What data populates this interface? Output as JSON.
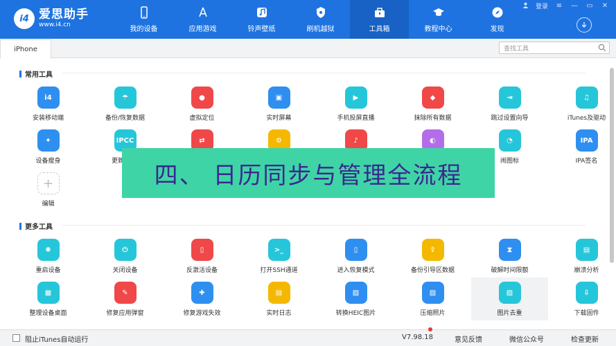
{
  "brand": {
    "badge": "i4",
    "name": "爱思助手",
    "url": "www.i4.cn"
  },
  "nav": [
    {
      "label": "我的设备",
      "icon": "phone-icon",
      "active": false
    },
    {
      "label": "应用游戏",
      "icon": "appstore-icon",
      "active": false
    },
    {
      "label": "铃声壁纸",
      "icon": "music-icon",
      "active": false
    },
    {
      "label": "刷机越狱",
      "icon": "shield-icon",
      "active": false
    },
    {
      "label": "工具箱",
      "icon": "toolbox-icon",
      "active": true
    },
    {
      "label": "教程中心",
      "icon": "graduation-cap-icon",
      "active": false
    },
    {
      "label": "发现",
      "icon": "compass-icon",
      "active": false
    }
  ],
  "window": {
    "login": "登录"
  },
  "tab": {
    "label": "iPhone"
  },
  "search": {
    "placeholder": "查找工具"
  },
  "sections": {
    "common": "常用工具",
    "more": "更多工具"
  },
  "common_tools": [
    {
      "label": "安装移动端",
      "icon": "i4-app-icon",
      "color": "#2f8ff0",
      "glyph": "i4"
    },
    {
      "label": "备份/恢复数据",
      "icon": "umbrella-icon",
      "color": "#26c6da",
      "glyph": "☂"
    },
    {
      "label": "虚拟定位",
      "icon": "location-pin-icon",
      "color": "#f04848",
      "glyph": "●"
    },
    {
      "label": "实时屏幕",
      "icon": "screen-icon",
      "color": "#2f8ff0",
      "glyph": "▣"
    },
    {
      "label": "手机投屏直播",
      "icon": "play-icon",
      "color": "#26c6da",
      "glyph": "▶"
    },
    {
      "label": "抹除所有数据",
      "icon": "eraser-icon",
      "color": "#f04848",
      "glyph": "◆"
    },
    {
      "label": "跳过设置向导",
      "icon": "skip-icon",
      "color": "#26c6da",
      "glyph": "⇥"
    },
    {
      "label": "iTunes及驱动",
      "icon": "itunes-icon",
      "color": "#26c6da",
      "glyph": "♫"
    },
    {
      "label": "设备瘦身",
      "icon": "broom-icon",
      "color": "#2f8ff0",
      "glyph": "✦"
    },
    {
      "label": "更新IPCC",
      "icon": "ipcc-icon",
      "color": "#26c6da",
      "glyph": "IPCC"
    },
    {
      "label": "",
      "icon": "transfer-icon",
      "color": "#f04848",
      "glyph": "⇄"
    },
    {
      "label": "",
      "icon": "gear-icon",
      "color": "#f5b800",
      "glyph": "⚙"
    },
    {
      "label": "",
      "icon": "music-note-icon",
      "color": "#f04848",
      "glyph": "♪"
    },
    {
      "label": "",
      "icon": "toggle-icon",
      "color": "#b46de8",
      "glyph": "◐"
    },
    {
      "label": "闹图标",
      "icon": "pie-icon",
      "color": "#26c6da",
      "glyph": "◔"
    },
    {
      "label": "IPA签名",
      "icon": "ipa-icon",
      "color": "#2f8ff0",
      "glyph": "IPA"
    },
    {
      "label": "编辑",
      "icon": "plus-icon",
      "color": "",
      "glyph": "+"
    }
  ],
  "more_tools": [
    {
      "label": "重启设备",
      "icon": "restart-icon",
      "color": "#26c6da",
      "glyph": "✺"
    },
    {
      "label": "关闭设备",
      "icon": "power-icon",
      "color": "#26c6da",
      "glyph": "⏻"
    },
    {
      "label": "反激活设备",
      "icon": "deactivate-icon",
      "color": "#f04848",
      "glyph": "▯"
    },
    {
      "label": "打开SSH通道",
      "icon": "terminal-icon",
      "color": "#26c6da",
      "glyph": ">_"
    },
    {
      "label": "进入恢复模式",
      "icon": "recovery-icon",
      "color": "#2f8ff0",
      "glyph": "▯"
    },
    {
      "label": "备份引导区数据",
      "icon": "backup-boot-icon",
      "color": "#f5b800",
      "glyph": "⇪"
    },
    {
      "label": "破解时间限额",
      "icon": "hourglass-icon",
      "color": "#2f8ff0",
      "glyph": "⧗"
    },
    {
      "label": "崩溃分析",
      "icon": "crash-report-icon",
      "color": "#26c6da",
      "glyph": "▤"
    },
    {
      "label": "整理设备桌面",
      "icon": "grid-icon",
      "color": "#26c6da",
      "glyph": "▦"
    },
    {
      "label": "修复应用弹窗",
      "icon": "repair-app-icon",
      "color": "#f04848",
      "glyph": "✎"
    },
    {
      "label": "修复游戏失效",
      "icon": "gamepad-icon",
      "color": "#2f8ff0",
      "glyph": "✚"
    },
    {
      "label": "实时日志",
      "icon": "log-icon",
      "color": "#f5b800",
      "glyph": "▤"
    },
    {
      "label": "转换HEIC图片",
      "icon": "heic-icon",
      "color": "#2f8ff0",
      "glyph": "▨"
    },
    {
      "label": "压缩照片",
      "icon": "compress-photo-icon",
      "color": "#2f8ff0",
      "glyph": "▨"
    },
    {
      "label": "图片去重",
      "icon": "dedupe-photo-icon",
      "color": "#26c6da",
      "glyph": "▨"
    },
    {
      "label": "下载固件",
      "icon": "download-firmware-icon",
      "color": "#26c6da",
      "glyph": "⇩"
    }
  ],
  "banner": {
    "text": "四、 日历同步与管理全流程"
  },
  "footer": {
    "itunes_label": "阻止iTunes自动运行",
    "version": "V7.98.18",
    "feedback": "意见反馈",
    "wechat": "微信公众号",
    "update": "检查更新"
  }
}
